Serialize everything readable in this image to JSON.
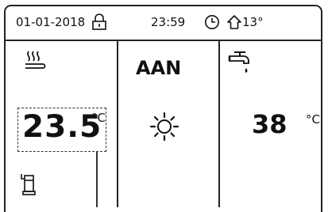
{
  "status_bar": {
    "date": "01-01-2018",
    "time": "23:59",
    "outdoor_temp": "13°",
    "icons": {
      "lock": "lock-icon",
      "clock": "clock-icon",
      "outdoor": "house-icon"
    }
  },
  "zones": {
    "heating": {
      "icon": "floor-heating-icon",
      "temperature": "23.5",
      "unit": "°C",
      "source_icon": "heat-pump-unit-icon"
    },
    "mode": {
      "state": "AAN",
      "icon": "sun-icon"
    },
    "hot_water": {
      "icon": "tap-icon",
      "temperature": "38",
      "unit": "°C"
    }
  }
}
